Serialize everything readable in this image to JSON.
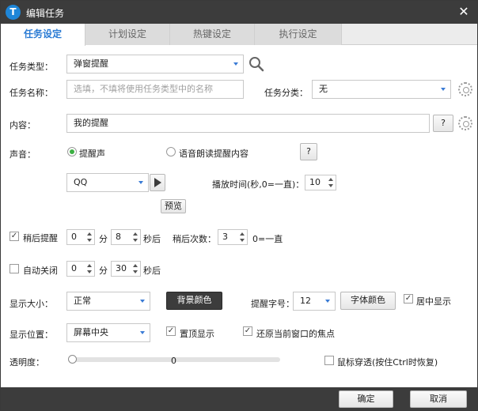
{
  "window": {
    "title": "编辑任务",
    "close_symbol": "✕"
  },
  "tabs": [
    {
      "label": "任务设定",
      "active": true
    },
    {
      "label": "计划设定",
      "active": false
    },
    {
      "label": "热键设定",
      "active": false
    },
    {
      "label": "执行设定",
      "active": false
    }
  ],
  "task_type": {
    "label": "任务类型：",
    "value": "弹窗提醒"
  },
  "task_name": {
    "label": "任务名称：",
    "placeholder": "选填，不填将使用任务类型中的名称"
  },
  "task_category": {
    "label": "任务分类：",
    "value": "无"
  },
  "content": {
    "label": "内容：",
    "value": "我的提醒",
    "help_label": "?"
  },
  "sound": {
    "label": "声音：",
    "option_tone": "提醒声",
    "option_tts": "语音朗读提醒内容",
    "help_label": "?",
    "tone_value": "QQ",
    "play_duration_label": "播放时间(秒,0=一直)：",
    "play_duration_value": "10",
    "preview_label": "预览"
  },
  "snooze": {
    "label": "稍后提醒",
    "minutes": "0",
    "minutes_unit": "分",
    "seconds": "8",
    "seconds_unit": "秒后",
    "count_label": "稍后次数：",
    "count_value": "3",
    "count_note": "0=一直",
    "checked": true
  },
  "auto_close": {
    "label": "自动关闭",
    "minutes": "0",
    "minutes_unit": "分",
    "seconds": "30",
    "seconds_unit": "秒后",
    "checked": false
  },
  "display_size": {
    "label": "显示大小：",
    "value": "正常",
    "bg_color_label": "背景颜色"
  },
  "font_size": {
    "label": "提醒字号：",
    "value": "12",
    "font_color_label": "字体颜色"
  },
  "center_display": {
    "label": "居中显示",
    "checked": true
  },
  "display_position": {
    "label": "显示位置：",
    "value": "屏幕中央"
  },
  "always_on_top": {
    "label": "置顶显示",
    "checked": true
  },
  "restore_focus": {
    "label": "还原当前窗口的焦点",
    "checked": true
  },
  "opacity": {
    "label": "透明度：",
    "value": "0"
  },
  "mouse_passthrough": {
    "label": "鼠标穿透(按住Ctrl时恢复)",
    "checked": false
  },
  "buttons": {
    "ok": "确定",
    "cancel": "取消"
  },
  "colors": {
    "titlebar": "#3c3c3c",
    "accent": "#2a7bd4",
    "radio_selected": "#3cb043"
  }
}
